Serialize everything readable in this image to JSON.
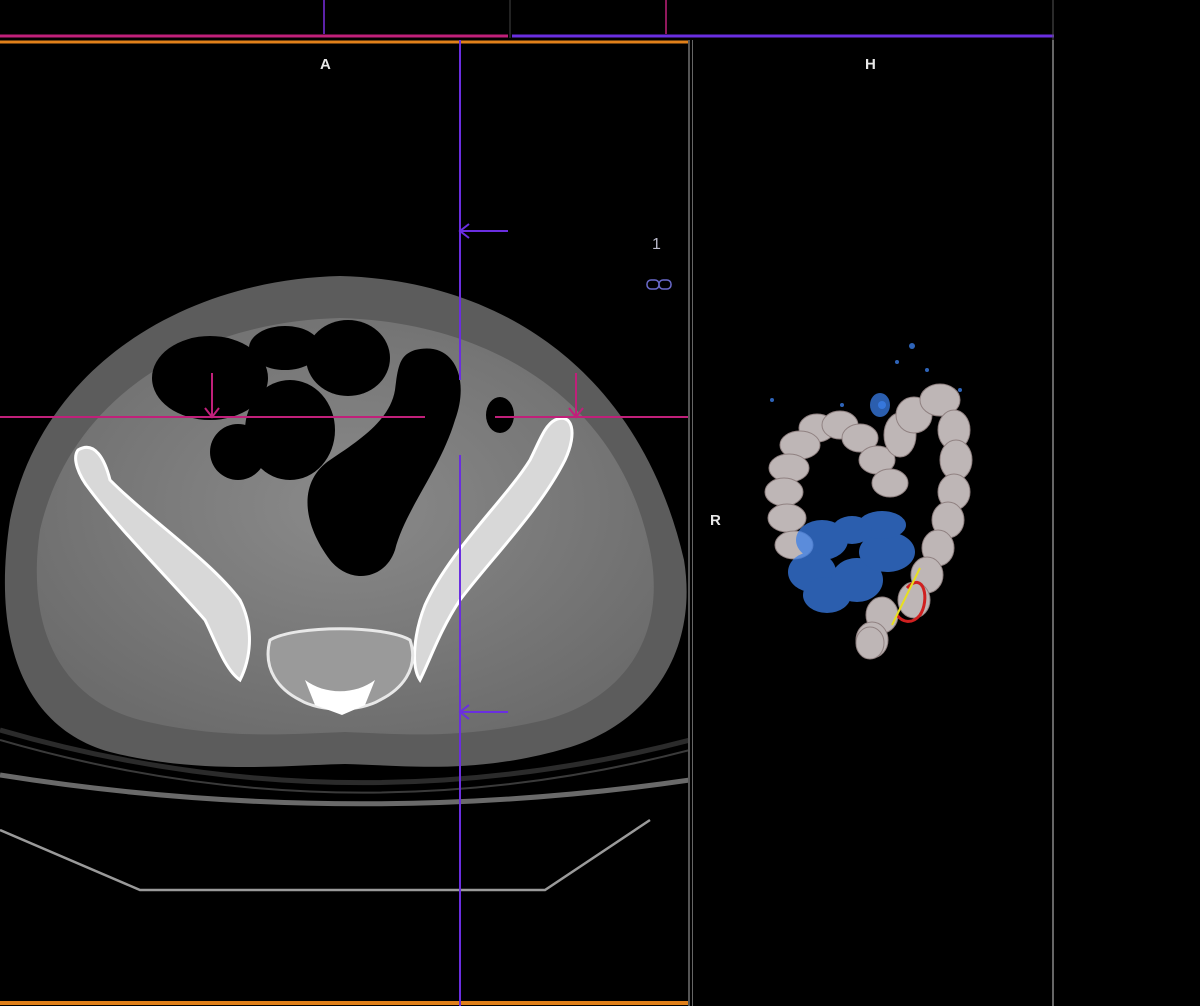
{
  "viewports": {
    "axial": {
      "label": "A",
      "slice_number": "1",
      "link_icon": "link-icon"
    },
    "volume3d": {
      "label": "H",
      "orientation": "R"
    }
  },
  "colors": {
    "axial_border": "#e0801a",
    "volume_border": "#7a2ee0",
    "crosshair_horizontal": "#c0207a",
    "crosshair_vertical": "#6a2ee0",
    "colon_wall": "#d8d0d0",
    "fluid": "#3a7ee8",
    "polyp_path": "#d02020",
    "measure": "#e8e020"
  }
}
